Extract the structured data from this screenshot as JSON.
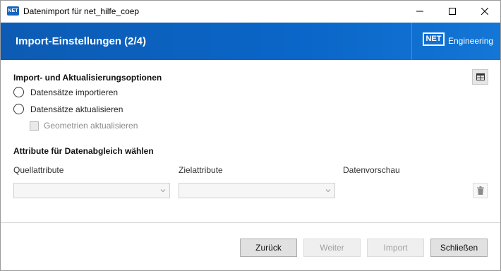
{
  "window": {
    "title": "Datenimport für net_hilfe_coep",
    "app_icon_text": "NET"
  },
  "header": {
    "title": "Import-Einstellungen (2/4)",
    "brand_box": "NET",
    "brand_text": "Engineering"
  },
  "options": {
    "section_title": "Import- und Aktualisierungsoptionen",
    "radio_import": "Datensätze importieren",
    "radio_update": "Datensätze aktualisieren",
    "checkbox_geometry": "Geometrien aktualisieren"
  },
  "attributes": {
    "section_title": "Attribute für Datenabgleich wählen",
    "col_source": "Quellattribute",
    "col_target": "Zielattribute",
    "col_preview": "Datenvorschau",
    "source_value": "",
    "target_value": ""
  },
  "buttons": {
    "back": "Zurück",
    "next": "Weiter",
    "import": "Import",
    "close": "Schließen"
  },
  "colors": {
    "header_blue": "#0a66c8",
    "window_bg": "#ffffff"
  }
}
